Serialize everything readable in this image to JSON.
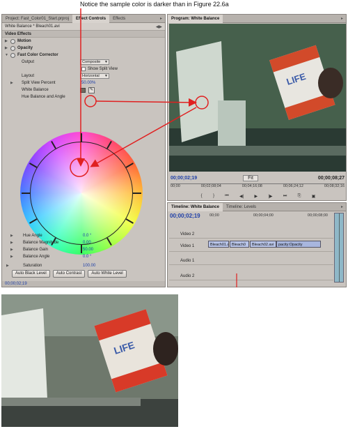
{
  "caption": "Notice the sample color is darker than in Figure 22.6a",
  "effect_controls": {
    "tabs": [
      "Project: Fast_Color01_Start.prproj",
      "Effect Controls",
      "Effects"
    ],
    "clip_label": "White Balance * Bleach01.avi",
    "section": "Video Effects",
    "motion": "Motion",
    "opacity": "Opacity",
    "fcc": "Fast Color Corrector",
    "output_label": "Output",
    "output_value": "Composite",
    "show_split": "Show Split View",
    "layout_label": "Layout",
    "layout_value": "Horizontal",
    "split_pct_label": "Split View Percent",
    "split_pct_value": "50.00%",
    "white_balance": "White Balance",
    "hue_balance": "Hue Balance and Angle",
    "hue_angle_label": "Hue Angle",
    "hue_angle_value": "0.0 °",
    "bal_mag_label": "Balance Magnitude",
    "bal_mag_value": "0.00",
    "bal_gain_label": "Balance Gain",
    "bal_gain_value": "50.00",
    "bal_angle_label": "Balance Angle",
    "bal_angle_value": "0.0 °",
    "saturation_label": "Saturation",
    "saturation_value": "100.00",
    "btn_black": "Auto Black Level",
    "btn_contrast": "Auto Contrast",
    "btn_white": "Auto White Level",
    "footer_tc": "00;00;02;19"
  },
  "program": {
    "title": "Program: White Balance",
    "tc_left": "00;00;02;19",
    "fit": "Fit",
    "tc_right": "00;00;08;27",
    "ruler": [
      "00;00",
      "00;02;08;04",
      "00;04;16;08",
      "00;06;24;12",
      "00;08;32;16"
    ]
  },
  "timeline": {
    "tabs": [
      "Timeline: White Balance",
      "Timeline: Levels"
    ],
    "tc": "00;00;02;19",
    "ruler": [
      "00;00",
      "00;00;04;00",
      "00;00;08;00"
    ],
    "tracks": [
      "Video 2",
      "Video 1",
      "Audio 1",
      "Audio 2"
    ],
    "clips": [
      "Bleach01.a",
      "Bleach0",
      "Bleach02.avi",
      "pacity:Opacity"
    ]
  },
  "colors": {
    "accent_red": "#e02020",
    "timecode_blue": "#1e3fa8"
  }
}
